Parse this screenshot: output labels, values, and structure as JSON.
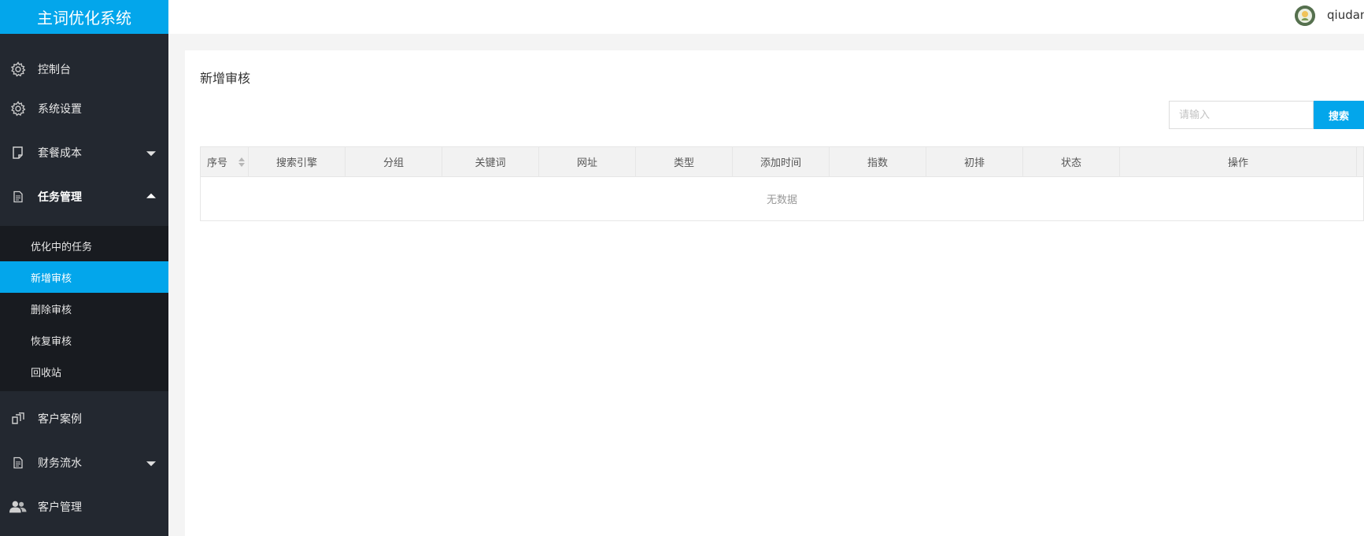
{
  "app": {
    "title": "主词优化系统"
  },
  "user": {
    "name": "qiudan"
  },
  "sidebar": {
    "items": [
      {
        "label": "控制台",
        "icon": "gear-icon"
      },
      {
        "label": "系统设置",
        "icon": "gear-icon"
      },
      {
        "label": "套餐成本",
        "icon": "document-icon",
        "expanded": false
      },
      {
        "label": "任务管理",
        "icon": "file-icon",
        "expanded": true
      },
      {
        "label": "客户案例",
        "icon": "cases-icon"
      },
      {
        "label": "财务流水",
        "icon": "file-icon",
        "expanded": false
      },
      {
        "label": "客户管理",
        "icon": "users-icon"
      }
    ],
    "task_submenu": [
      {
        "label": "优化中的任务"
      },
      {
        "label": "新增审核",
        "selected": true
      },
      {
        "label": "删除审核"
      },
      {
        "label": "恢复审核"
      },
      {
        "label": "回收站"
      }
    ]
  },
  "main": {
    "title": "新增审核",
    "search": {
      "placeholder": "请输入",
      "value": "",
      "button_label": "搜索"
    },
    "table": {
      "columns": [
        "序号",
        "搜索引擎",
        "分组",
        "关键词",
        "网址",
        "类型",
        "添加时间",
        "指数",
        "初排",
        "状态",
        "操作"
      ],
      "rows": [],
      "empty_text": "无数据"
    }
  },
  "colors": {
    "accent": "#03a6eb",
    "sidebar_bg": "#232830",
    "submenu_bg": "#181b20"
  }
}
